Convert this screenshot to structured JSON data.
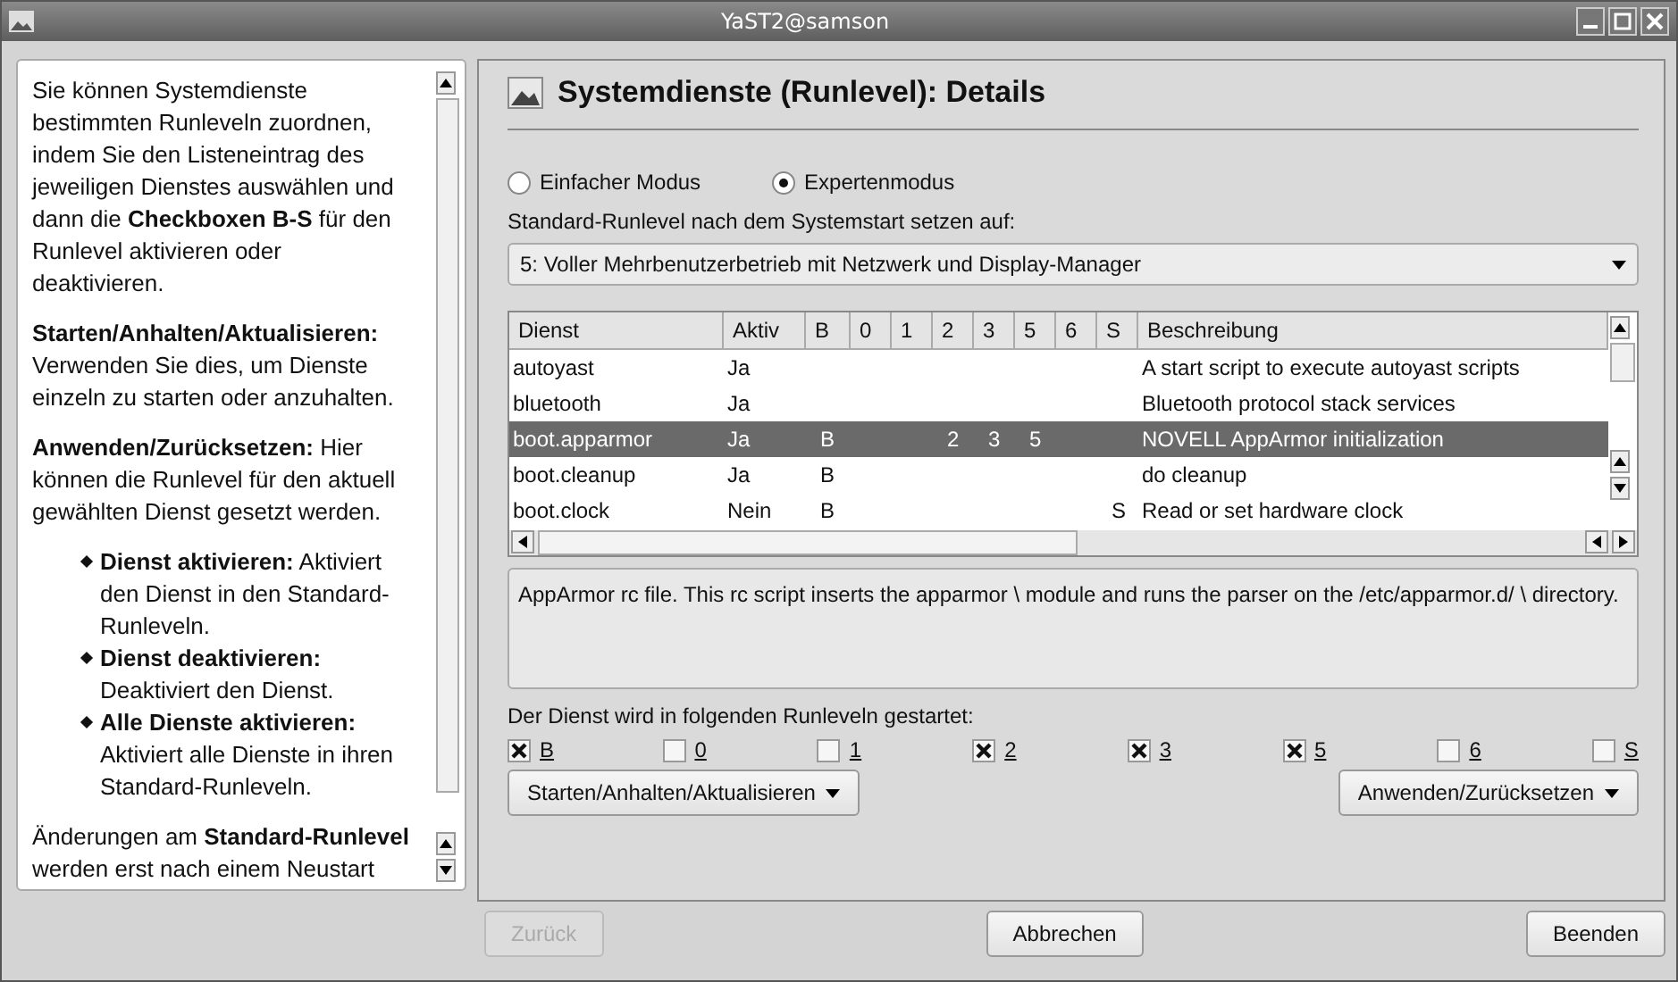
{
  "window": {
    "title": "YaST2@samson"
  },
  "help": {
    "blocks": [
      {
        "kind": "para",
        "text": "Sie können Systemdienste bestimmten Runleveln zuordnen, indem Sie den Listeneintrag des jeweiligen Dienstes auswählen und dann die **Checkboxen B-S** für den Runlevel aktivieren oder deaktivieren."
      },
      {
        "kind": "para",
        "text": "**Starten/Anhalten/Aktualisieren:** Verwenden Sie dies, um Dienste einzeln zu starten oder anzuhalten."
      },
      {
        "kind": "para",
        "text": "**Anwenden/Zurücksetzen:** Hier können die Runlevel für den aktuell gewählten Dienst gesetzt werden."
      },
      {
        "kind": "list",
        "items": [
          "**Dienst aktivieren:** Aktiviert den Dienst in den Standard-Runleveln.",
          "**Dienst deaktivieren:** Deaktiviert den Dienst.",
          "**Alle Dienste aktivieren:** Aktiviert alle Dienste in ihren Standard-Runleveln."
        ]
      },
      {
        "kind": "para",
        "text": "Änderungen am **Standard-Runlevel** werden erst nach einem Neustart"
      }
    ]
  },
  "main": {
    "heading": "Systemdienste (Runlevel): Details",
    "modes": [
      {
        "label": "Einfacher Modus",
        "selected": false
      },
      {
        "label": "Expertenmodus",
        "selected": true
      }
    ],
    "default_runlevel": {
      "label": "Standard-Runlevel nach dem Systemstart setzen auf:",
      "value": "5: Voller Mehrbenutzerbetrieb mit Netzwerk und Display-Manager"
    },
    "table": {
      "columns": [
        "Dienst",
        "Aktiv",
        "B",
        "0",
        "1",
        "2",
        "3",
        "5",
        "6",
        "S",
        "Beschreibung"
      ],
      "rows": [
        {
          "selected": false,
          "cells": [
            "autoyast",
            "Ja",
            "",
            "",
            "",
            "",
            "",
            "",
            "",
            "",
            "A start script to execute autoyast scripts"
          ]
        },
        {
          "selected": false,
          "cells": [
            "bluetooth",
            "Ja",
            "",
            "",
            "",
            "",
            "",
            "",
            "",
            "",
            "Bluetooth protocol stack services"
          ]
        },
        {
          "selected": true,
          "cells": [
            "boot.apparmor",
            "Ja",
            "B",
            "",
            "",
            "2",
            "3",
            "5",
            "",
            "",
            "NOVELL AppArmor initialization"
          ]
        },
        {
          "selected": false,
          "cells": [
            "boot.cleanup",
            "Ja",
            "B",
            "",
            "",
            "",
            "",
            "",
            "",
            "",
            "do cleanup"
          ]
        },
        {
          "selected": false,
          "cells": [
            "boot.clock",
            "Nein",
            "B",
            "",
            "",
            "",
            "",
            "",
            "",
            "S",
            "Read or set hardware clock"
          ]
        }
      ]
    },
    "description": "AppArmor rc file. This rc script inserts the apparmor \\ module and runs the parser on the /etc/apparmor.d/ \\ directory.",
    "runlevels_label": "Der Dienst wird in folgenden Runleveln gestartet:",
    "runlevels": [
      {
        "label": "B",
        "checked": true
      },
      {
        "label": "0",
        "checked": false
      },
      {
        "label": "1",
        "checked": false
      },
      {
        "label": "2",
        "checked": true
      },
      {
        "label": "3",
        "checked": true
      },
      {
        "label": "5",
        "checked": true
      },
      {
        "label": "6",
        "checked": false
      },
      {
        "label": "S",
        "checked": false
      }
    ],
    "left_button": "Starten/Anhalten/Aktualisieren",
    "right_button": "Anwenden/Zurücksetzen"
  },
  "footer": [
    {
      "label": "Zurück",
      "disabled": true
    },
    {
      "label": "Abbrechen",
      "disabled": false
    },
    {
      "label": "Beenden",
      "disabled": false
    }
  ]
}
